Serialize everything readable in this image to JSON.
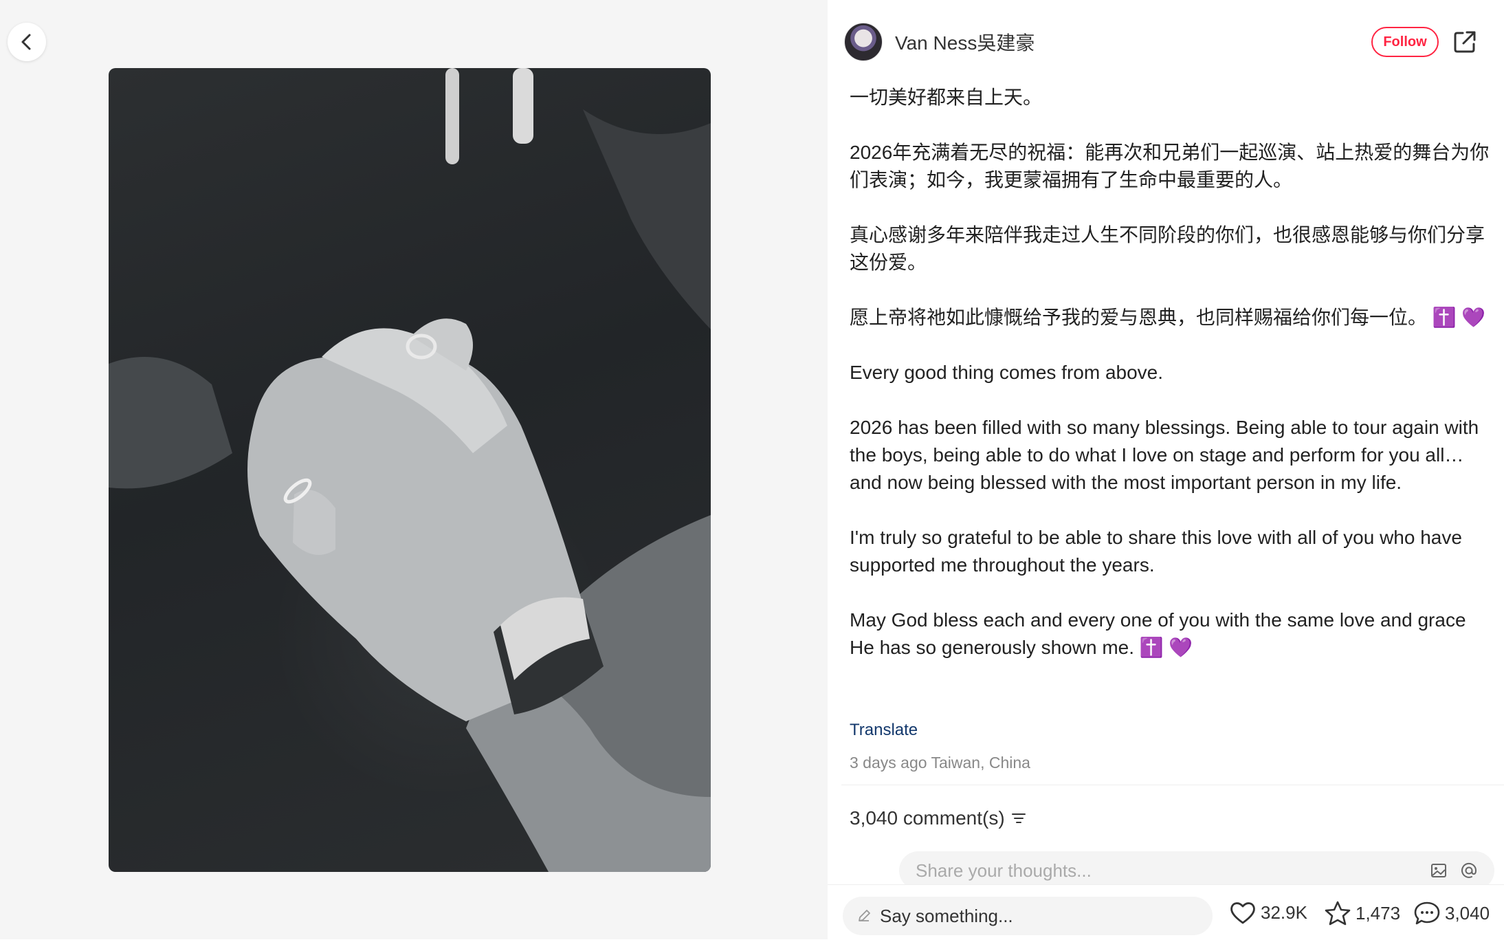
{
  "author": {
    "name": "Van Ness吳建豪",
    "follow_label": "Follow"
  },
  "post": {
    "paragraphs": [
      "一切美好都来自上天。",
      "2026年充满着无尽的祝福：能再次和兄弟们一起巡演、站上热爱的舞台为你们表演；如今，我更蒙福拥有了生命中最重要的人。",
      "真心感谢多年来陪伴我走过人生不同阶段的你们，也很感恩能够与你们分享这份爱。",
      "愿上帝将祂如此慷慨给予我的爱与恩典，也同样赐福给你们每一位。 ✝️ 💜",
      "Every good thing comes from above.",
      "2026 has been filled with so many blessings. Being able to tour again with the boys, being able to do what I love on stage and perform for you all… and now being blessed with the most important person in my life.",
      "I'm truly so grateful to be able to share this love with all of you who have supported me throughout the years.",
      "May God bless each and every one of you with the same love and grace He has so generously shown me. ✝️ 💜"
    ],
    "translate_label": "Translate",
    "meta": "3 days ago Taiwan, China"
  },
  "comments": {
    "count_label": "3,040 comment(s)",
    "input_placeholder": "Share your thoughts..."
  },
  "bottom_bar": {
    "say_placeholder": "Say something...",
    "likes": "32.9K",
    "collects": "1,473",
    "comments": "3,040"
  },
  "colors": {
    "accent": "#ff2442",
    "link": "#13386c",
    "left_bg": "#f5f5f5"
  },
  "icons": [
    "back-arrow-icon",
    "share-icon",
    "filter-icon",
    "image-icon",
    "at-icon",
    "pencil-icon",
    "heart-icon",
    "star-icon",
    "comment-icon"
  ]
}
